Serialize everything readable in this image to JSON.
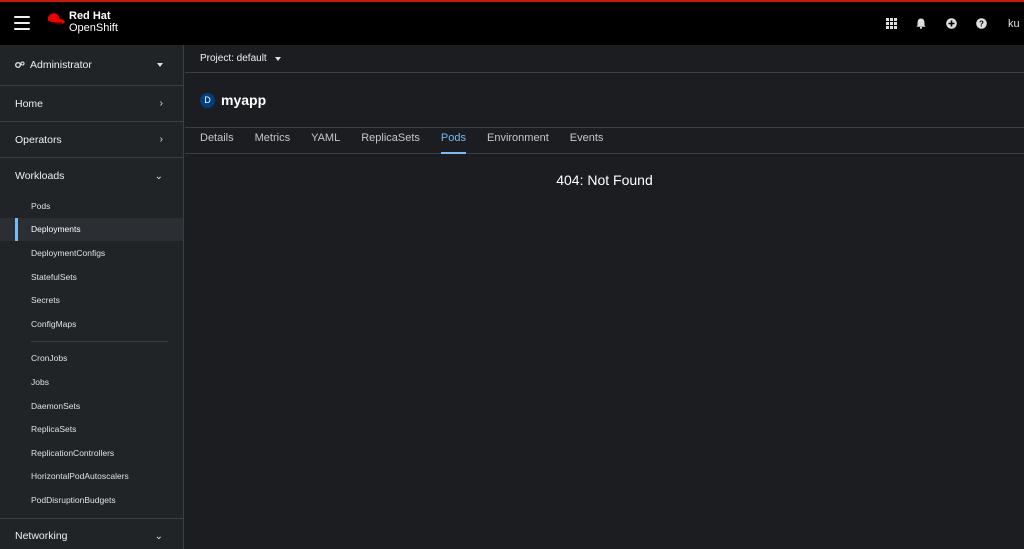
{
  "masthead": {
    "brand": "Red Hat",
    "product": "OpenShift",
    "icons": [
      "app-launcher-icon",
      "bell-icon",
      "plus-circle-icon",
      "help-icon"
    ],
    "user": "ku"
  },
  "sidebar": {
    "perspective": "Administrator",
    "sections": {
      "home": "Home",
      "operators": "Operators",
      "workloads": "Workloads",
      "networking": "Networking"
    },
    "workloads_items": [
      "Pods",
      "Deployments",
      "DeploymentConfigs",
      "StatefulSets",
      "Secrets",
      "ConfigMaps",
      "CronJobs",
      "Jobs",
      "DaemonSets",
      "ReplicaSets",
      "ReplicationControllers",
      "HorizontalPodAutoscalers",
      "PodDisruptionBudgets"
    ],
    "active_item": "Deployments"
  },
  "main": {
    "project": "Project: default",
    "resource_badge": "D",
    "resource_name": "myapp",
    "tabs": [
      "Details",
      "Metrics",
      "YAML",
      "ReplicaSets",
      "Pods",
      "Environment",
      "Events"
    ],
    "active_tab": "Pods",
    "error": "404: Not Found"
  },
  "colors": {
    "accent": "#73bcf7",
    "brand_red": "#ee0000",
    "badge": "#004080"
  }
}
